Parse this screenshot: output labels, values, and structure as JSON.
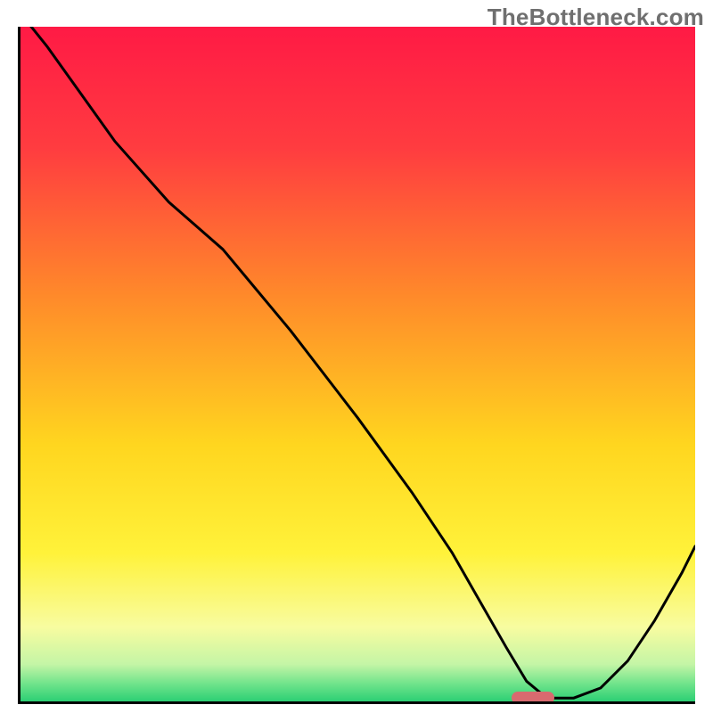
{
  "watermark": "TheBottleneck.com",
  "colors": {
    "curve": "#000000",
    "marker": "#d96a6f",
    "axis": "#000000",
    "gradient_stops": [
      {
        "offset": 0.0,
        "color": "#ff1a45"
      },
      {
        "offset": 0.18,
        "color": "#ff3c40"
      },
      {
        "offset": 0.4,
        "color": "#ff8a2a"
      },
      {
        "offset": 0.62,
        "color": "#ffd61f"
      },
      {
        "offset": 0.78,
        "color": "#fff23a"
      },
      {
        "offset": 0.89,
        "color": "#f8fca0"
      },
      {
        "offset": 0.945,
        "color": "#c4f5a6"
      },
      {
        "offset": 0.975,
        "color": "#6de38a"
      },
      {
        "offset": 1.0,
        "color": "#2ccf74"
      }
    ]
  },
  "chart_data": {
    "type": "line",
    "title": "",
    "xlabel": "",
    "ylabel": "",
    "xlim": [
      0,
      100
    ],
    "ylim": [
      0,
      100
    ],
    "x": [
      0,
      4,
      14,
      22,
      30,
      40,
      50,
      58,
      64,
      68,
      72,
      75,
      78,
      82,
      86,
      90,
      94,
      98,
      100
    ],
    "values": [
      102,
      97,
      83,
      74,
      67,
      55,
      42,
      31,
      22,
      15,
      8,
      3,
      0.5,
      0.5,
      2,
      6,
      12,
      19,
      23
    ],
    "marker": {
      "x": 76,
      "y": 0.5
    }
  }
}
